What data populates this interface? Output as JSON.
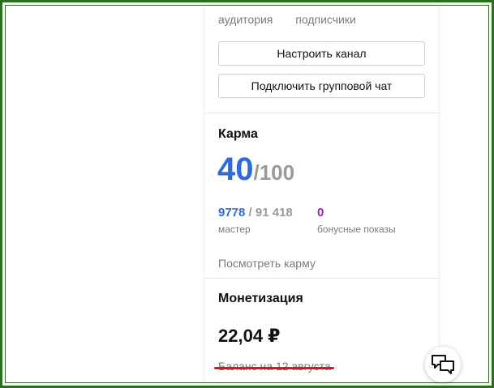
{
  "audience": {
    "label_1": "аудитория",
    "label_2": "подписчики"
  },
  "buttons": {
    "configure_channel": "Настроить канал",
    "connect_group_chat": "Подключить групповой чат"
  },
  "karma": {
    "title": "Карма",
    "score": "40",
    "max": "/100",
    "master_value": "9778",
    "master_total": "/ 91 418",
    "master_label": "мастер",
    "bonus_value": "0",
    "bonus_label": "бонусные показы",
    "link": "Посмотреть карму"
  },
  "monetization": {
    "title": "Монетизация",
    "amount": "22,04 ₽",
    "balance_label": "Баланс на 12 августа"
  },
  "colors": {
    "accent_blue": "#2f6bd8",
    "bonus_purple": "#a21fb8",
    "highlight_red": "#d11b1b",
    "frame_green": "#2c6e1f"
  },
  "icons": {
    "chat": "chat-bubbles-icon"
  }
}
